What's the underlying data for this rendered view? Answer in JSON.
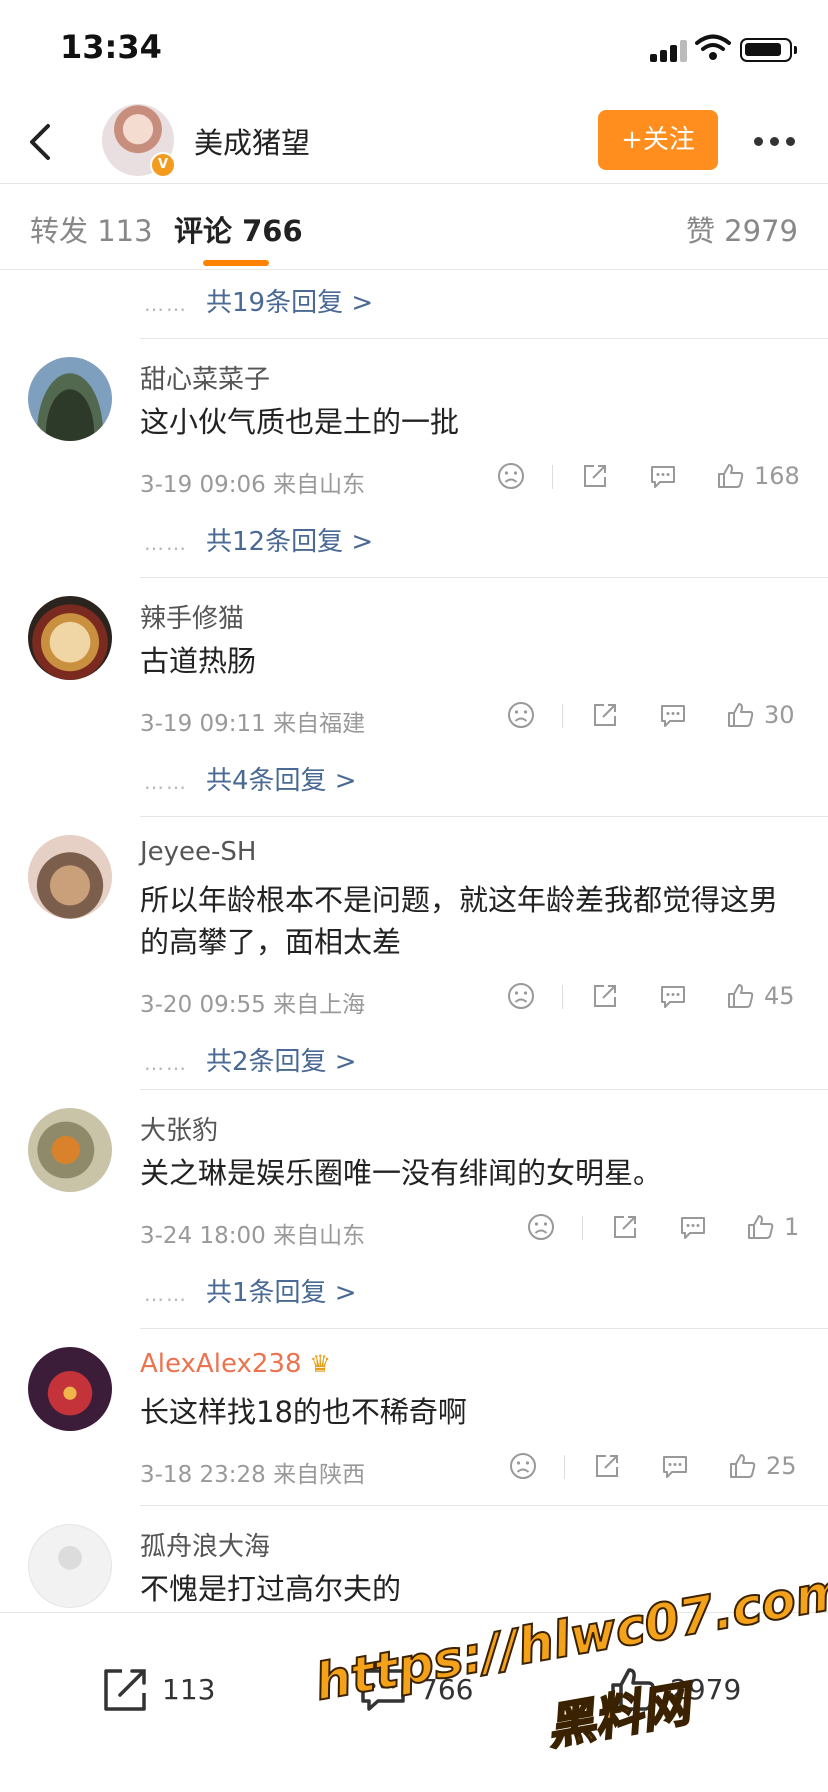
{
  "status_bar": {
    "time": "13:34"
  },
  "header": {
    "user_name": "美成猪望",
    "follow_label": "+关注"
  },
  "tabs": {
    "repost": "转发 113",
    "comments": "评论 766",
    "likes": "赞 2979"
  },
  "first_replies": "共19条回复 >",
  "comments": [
    {
      "name": "甜心菜菜子",
      "text": "这小伙气质也是土的一批",
      "meta": "3-19 09:06  来自山东",
      "likes": "168",
      "replies": "共12条回复 >"
    },
    {
      "name": "辣手修猫",
      "text": "古道热肠",
      "meta": "3-19 09:11  来自福建",
      "likes": "30",
      "replies": "共4条回复 >"
    },
    {
      "name": "Jeyee-SH",
      "text": "所以年龄根本不是问题，就这年龄差我都觉得这男的高攀了，面相太差",
      "meta": "3-20 09:55  来自上海",
      "likes": "45",
      "replies": "共2条回复 >"
    },
    {
      "name": "大张豹",
      "text": "关之琳是娱乐圈唯一没有绯闻的女明星。",
      "meta": "3-24 18:00  来自山东",
      "likes": "1",
      "replies": "共1条回复 >"
    },
    {
      "name": "AlexAlex238",
      "text": "长这样找18的也不稀奇啊",
      "meta": "3-18 23:28  来自陕西",
      "likes": "25"
    },
    {
      "name": "孤舟浪大海",
      "text": "不愧是打过高尔夫的"
    }
  ],
  "bottom_bar": {
    "repost_count": "113",
    "comment_count": "766",
    "like_count": "2979"
  },
  "watermark": {
    "url": "https://hlwc07.com",
    "site": "黑料网"
  },
  "colors": {
    "accent": "#ff8200",
    "link": "#4a6a95",
    "vip_name": "#eb7350"
  }
}
